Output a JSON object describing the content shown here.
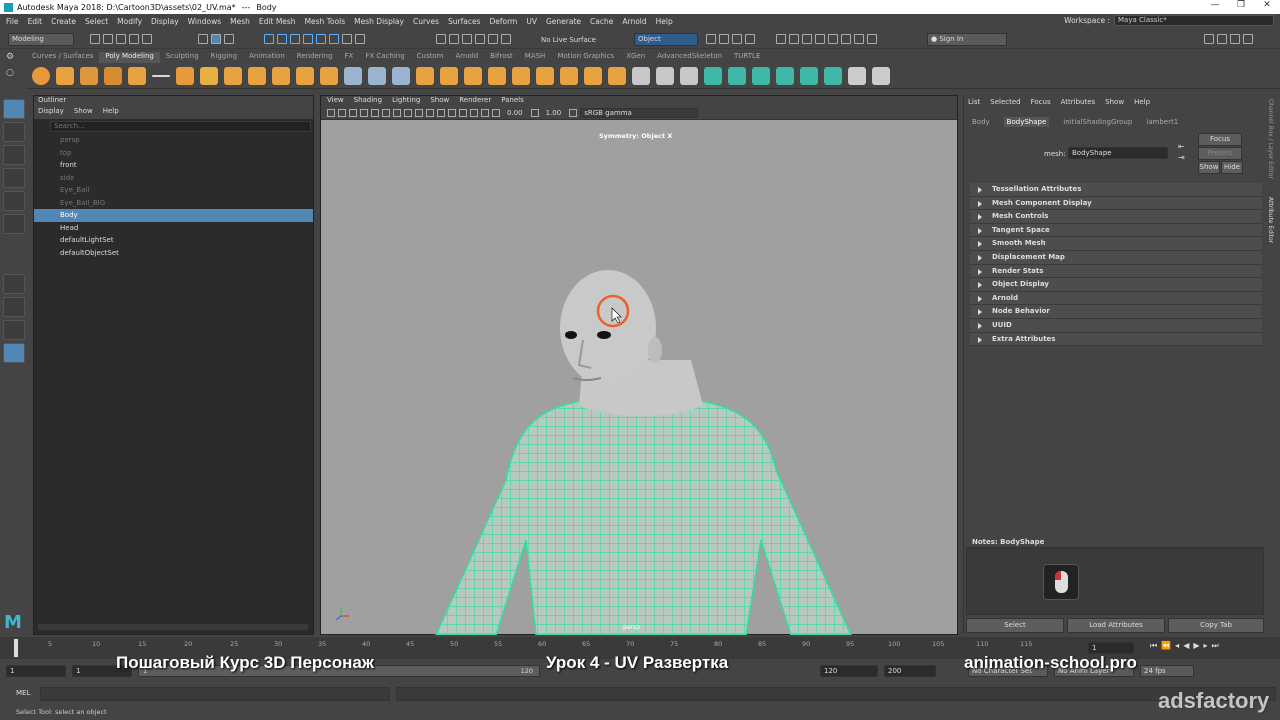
{
  "window": {
    "title_app": "Autodesk Maya 2018: D:\\Cartoon3D\\assets\\02_UV.ma*",
    "title_sep": "---",
    "title_obj": "Body",
    "controls": [
      "—",
      "❐",
      "✕"
    ]
  },
  "menubar": {
    "items": [
      "File",
      "Edit",
      "Create",
      "Select",
      "Modify",
      "Display",
      "Windows",
      "Mesh",
      "Edit Mesh",
      "Mesh Tools",
      "Mesh Display",
      "Curves",
      "Surfaces",
      "Deform",
      "UV",
      "Generate",
      "Cache",
      "Arnold",
      "Help"
    ],
    "workspace_label": "Workspace :",
    "workspace_value": "Maya Classic*"
  },
  "statusline": {
    "mode": "Modeling",
    "live_surface": "No Live Surface",
    "object_mode": "Object",
    "sign_in": "Sign In"
  },
  "shelf": {
    "tabs": [
      "Curves / Surfaces",
      "Poly Modeling",
      "Sculpting",
      "Rigging",
      "Animation",
      "Rendering",
      "FX",
      "FX Caching",
      "Custom",
      "Arnold",
      "Bifrost",
      "MASH",
      "Motion Graphics",
      "XGen",
      "AdvancedSkeleton",
      "TURTLE"
    ],
    "active_tab": "Poly Modeling"
  },
  "outliner": {
    "title": "Outliner",
    "menu": [
      "Display",
      "Show",
      "Help"
    ],
    "search_placeholder": "Search...",
    "items": [
      {
        "label": "persp",
        "dim": true
      },
      {
        "label": "top",
        "dim": true
      },
      {
        "label": "front",
        "dim": false
      },
      {
        "label": "side",
        "dim": true
      },
      {
        "label": "Eye_Ball",
        "dim": true
      },
      {
        "label": "Eye_Ball_BIG",
        "dim": true
      },
      {
        "label": "Body",
        "selected": true
      },
      {
        "label": "Head",
        "dim": false
      },
      {
        "label": "defaultLightSet",
        "dim": false
      },
      {
        "label": "defaultObjectSet",
        "dim": false
      }
    ]
  },
  "viewport": {
    "menu": [
      "View",
      "Shading",
      "Lighting",
      "Show",
      "Renderer",
      "Panels"
    ],
    "near_value": "0.00",
    "far_value": "1.00",
    "color_space": "sRGB gamma",
    "symmetry": "Symmetry: Object X",
    "camera": "persp"
  },
  "attribute_editor": {
    "menu": [
      "List",
      "Selected",
      "Focus",
      "Attributes",
      "Show",
      "Help"
    ],
    "tabs": [
      "Body",
      "BodyShape",
      "initialShadingGroup",
      "lambert1"
    ],
    "active_tab": "BodyShape",
    "mesh_label": "mesh:",
    "mesh_value": "BodyShape",
    "focus": "Focus",
    "presets": "Presets",
    "show": "Show",
    "hide": "Hide",
    "sections": [
      "Tessellation Attributes",
      "Mesh Component Display",
      "Mesh Controls",
      "Tangent Space",
      "Smooth Mesh",
      "Displacement Map",
      "Render Stats",
      "Object Display",
      "Arnold",
      "Node Behavior",
      "UUID",
      "Extra Attributes"
    ],
    "notes_label": "Notes:  BodyShape",
    "buttons": [
      "Select",
      "Load Attributes",
      "Copy Tab"
    ]
  },
  "side_tabs": [
    "Channel Box / Layer Editor",
    "Attribute Editor"
  ],
  "timeline": {
    "ticks": [
      "5",
      "10",
      "15",
      "20",
      "25",
      "30",
      "35",
      "40",
      "45",
      "50",
      "55",
      "60",
      "65",
      "70",
      "75",
      "80",
      "85",
      "90",
      "95",
      "100",
      "105",
      "110",
      "115"
    ],
    "current_frame": "1"
  },
  "range": {
    "start": "1",
    "start_inner": "1",
    "range_start": "1",
    "range_end": "120",
    "end_inner": "120",
    "end": "200",
    "char_set": "No Character Set",
    "anim_layer": "No Anim Layer",
    "fps": "24 fps"
  },
  "cmdline": {
    "label": "MEL"
  },
  "helpline": {
    "text": "Select Tool: select an object"
  },
  "overlay": {
    "course": "Пошаговый Курс 3D Персонаж",
    "lesson": "Урок 4 - UV Развертка",
    "site": "animation-school.pro",
    "watermark": "adsfactory"
  },
  "colors": {
    "selection": "#5286b4",
    "wireframe": "#2fe0a0",
    "viewport_bg": "#a0a0a0",
    "cursor_ring": "#e8622a"
  }
}
